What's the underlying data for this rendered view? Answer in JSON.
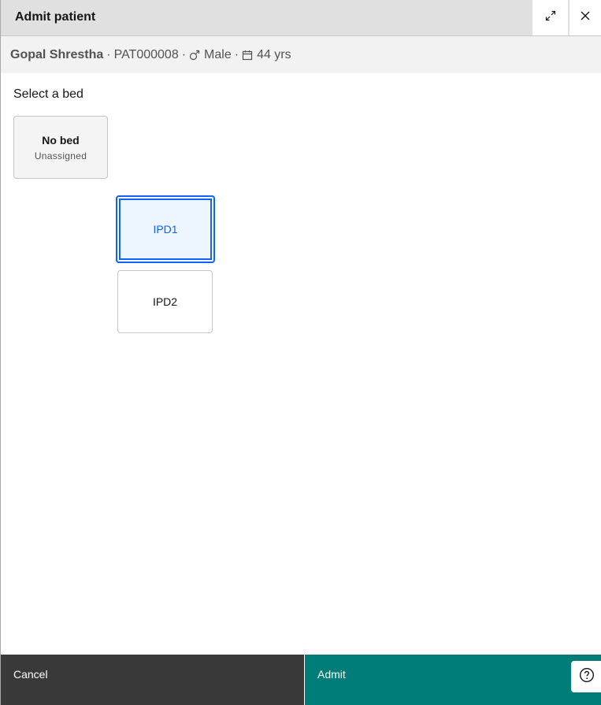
{
  "header": {
    "title": "Admit patient",
    "maximize_icon": "maximize-icon",
    "close_icon": "close-icon"
  },
  "patient": {
    "name": "Gopal Shrestha",
    "id": "PAT000008",
    "separator": "·",
    "gender": "Male",
    "gender_icon": "male-icon",
    "age": "44 yrs",
    "age_icon": "calendar-icon"
  },
  "bed_selection": {
    "title": "Select a bed",
    "no_bed": {
      "label": "No bed",
      "sublabel": "Unassigned"
    },
    "beds": [
      {
        "label": "IPD1",
        "selected": true
      },
      {
        "label": "IPD2",
        "selected": false
      }
    ]
  },
  "footer": {
    "cancel_label": "Cancel",
    "admit_label": "Admit",
    "help_icon": "help-icon"
  },
  "colors": {
    "header_bg": "#e0e0e0",
    "banner_bg": "#f2f2f2",
    "selected_border": "#0f62fe",
    "selected_bg": "#edf5ff",
    "cancel_bg": "#393939",
    "admit_bg": "#007d79"
  }
}
